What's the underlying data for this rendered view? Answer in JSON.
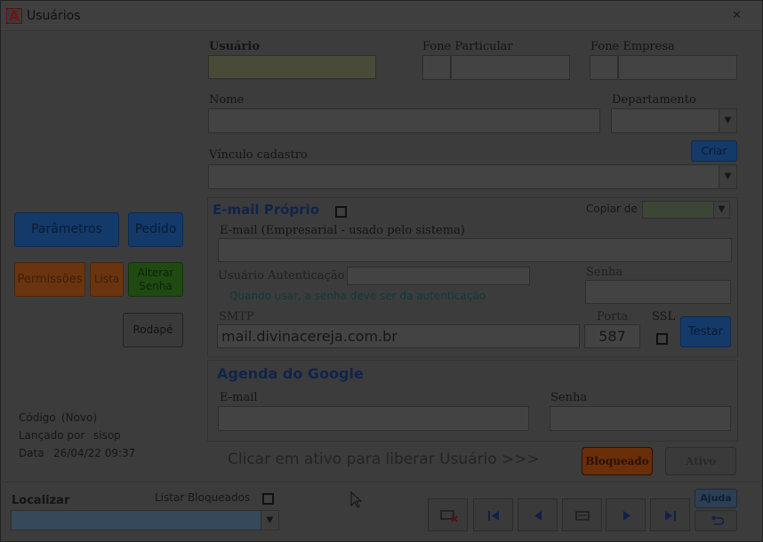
{
  "window": {
    "title": "Usuários",
    "app_icon_letter": "A",
    "close_glyph": "✕"
  },
  "fields": {
    "usuario_label": "Usuário",
    "fone_particular_label": "Fone Particular",
    "fone_empresa_label": "Fone Empresa",
    "nome_label": "Nome",
    "departamento_label": "Departamento",
    "vinculo_label": "Vínculo cadastro",
    "criar_button": "Criar"
  },
  "left_buttons": {
    "parametros": "Parâmetros",
    "pedido": "Pedido",
    "permissoes": "Permissões",
    "lista": "Lista",
    "alterar_senha": "Alterar Senha",
    "rodape": "Rodapé"
  },
  "info": {
    "codigo_label": "Código",
    "codigo_value": "(Novo)",
    "lancado_label": "Lançado por",
    "lancado_value": "sisop",
    "data_label": "Data",
    "data_value": "26/04/22 09:37"
  },
  "email_section": {
    "title": "E-mail Próprio",
    "copiar_label": "Copiar de",
    "email_label": "E-mail (Empresarial - usado pelo sistema)",
    "usuario_auth_label": "Usuário Autenticação",
    "senha_label": "Senha",
    "hint": "Quando usar, a senha deve ser da autenticação",
    "smtp_label": "SMTP",
    "smtp_value": "mail.divinacereja.com.br",
    "porta_label": "Porta",
    "porta_value": "587",
    "ssl_label": "SSL",
    "testar_button": "Testar"
  },
  "google_section": {
    "title": "Agenda do Google",
    "email_label": "E-mail",
    "senha_label": "Senha"
  },
  "status": {
    "message": "Clicar em ativo para liberar Usuário >>>",
    "bloqueado_button": "Bloqueado",
    "ativo_button": "Ativo"
  },
  "bottom": {
    "localizar_label": "Localizar",
    "listar_bloqueados_label": "Listar Bloqueados",
    "ajuda_button": "Ajuda"
  },
  "icons": {
    "dropdown": "chevron-down-icon",
    "first": "first-record-icon",
    "prev": "previous-record-icon",
    "next": "next-record-icon",
    "last": "last-record-icon",
    "undo": "undo-icon"
  },
  "colors": {
    "overlay_bg": "#3c3c3c",
    "blue_button": "#143a6a",
    "orange_button": "#6a340f",
    "green_button": "#1f4a12",
    "usuario_field": "#4a4a38",
    "localizar_field": "#36495a"
  }
}
